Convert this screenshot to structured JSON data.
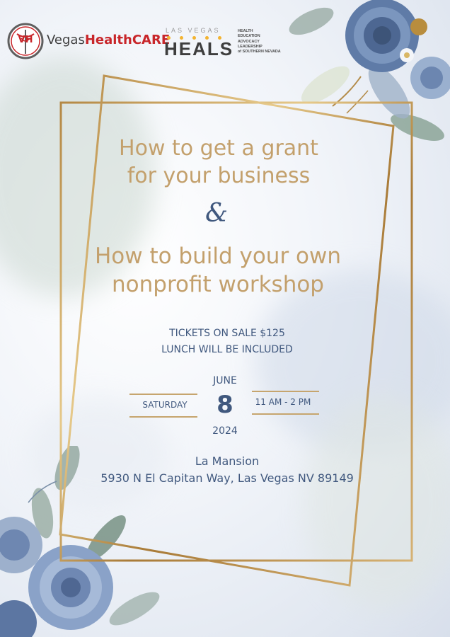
{
  "logos": {
    "vegas_health_care": {
      "initials": "VH",
      "word1": "Vegas",
      "word2": "HealthCARE"
    },
    "heals": {
      "top": "LAS VEGAS",
      "main": "HEALS",
      "lines": [
        "HEALTH",
        "EDUCATION",
        "ADVOCACY",
        "LEADERSHIP",
        "of SOUTHERN NEVADA"
      ]
    }
  },
  "title": {
    "line1": "How to get a grant",
    "line2": "for your business",
    "ampersand": "&",
    "line3": "How to build your own",
    "line4": "nonprofit workshop"
  },
  "tickets": {
    "line1": "TICKETS ON SALE $125",
    "line2": "LUNCH WILL BE INCLUDED"
  },
  "date": {
    "month": "JUNE",
    "day": "8",
    "year": "2024",
    "weekday": "SATURDAY",
    "time": "11 AM - 2 PM"
  },
  "venue": {
    "name": "La Mansion",
    "address": "5930 N El Capitan Way, Las Vegas NV 89149"
  },
  "colors": {
    "gold": "#c3a06c",
    "navy": "#40587e",
    "brand_red": "#c8262a",
    "heals_gold": "#f3b330"
  }
}
